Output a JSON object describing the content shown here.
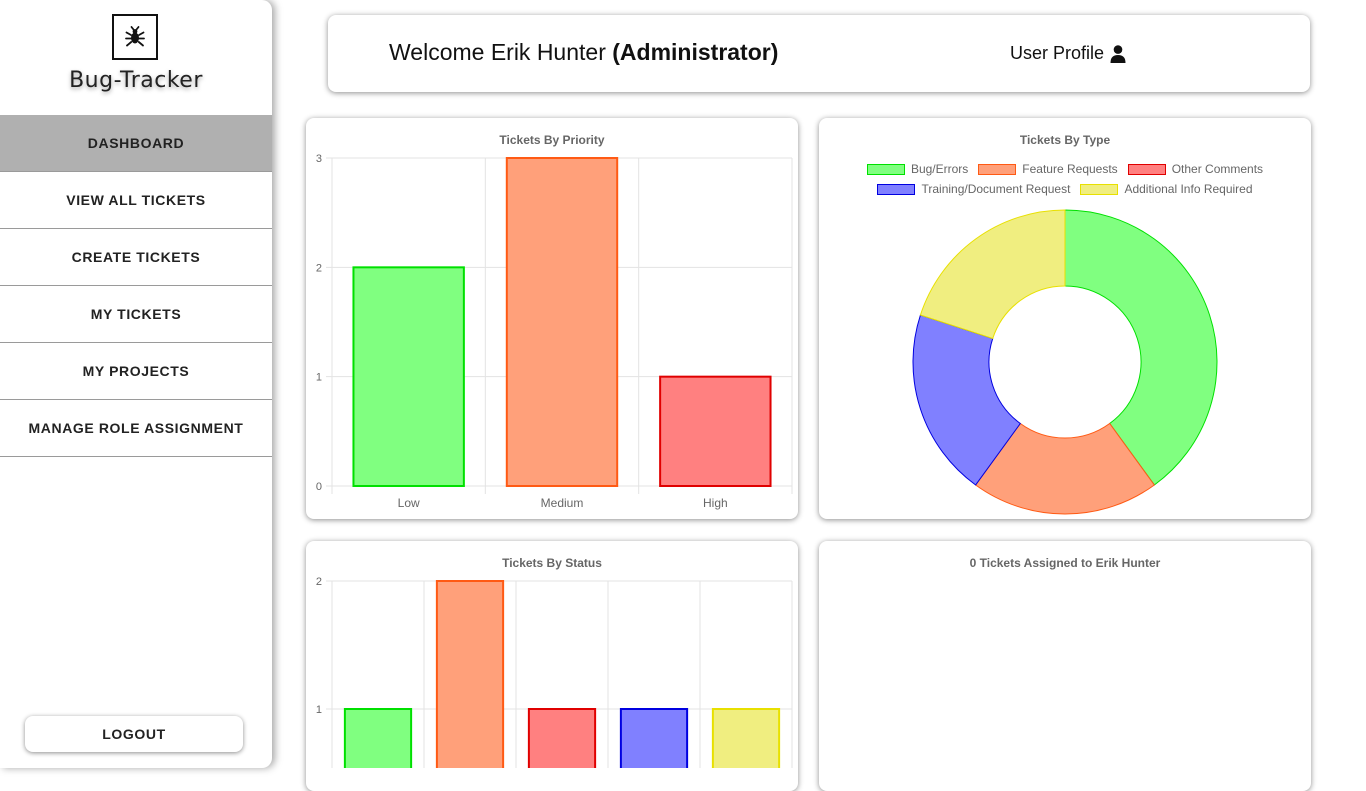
{
  "app": {
    "name": "Bug-Tracker"
  },
  "sidebar": {
    "items": [
      {
        "label": "DASHBOARD",
        "active": true
      },
      {
        "label": "VIEW ALL TICKETS",
        "active": false
      },
      {
        "label": "CREATE TICKETS",
        "active": false
      },
      {
        "label": "MY TICKETS",
        "active": false
      },
      {
        "label": "MY PROJECTS",
        "active": false
      },
      {
        "label": "MANAGE ROLE ASSIGNMENT",
        "active": false
      }
    ],
    "logout_label": "LOGOUT"
  },
  "header": {
    "welcome_prefix": "Welcome Erik Hunter",
    "role": "(Administrator)",
    "profile_label": "User Profile"
  },
  "palette": {
    "green": {
      "fill": "#80ff80",
      "stroke": "#00e000"
    },
    "orange": {
      "fill": "#ffa07a",
      "stroke": "#ff5a14"
    },
    "red": {
      "fill": "#ff8080",
      "stroke": "#e00000"
    },
    "blue": {
      "fill": "#8080ff",
      "stroke": "#0000e0"
    },
    "yellow": {
      "fill": "#f0ee80",
      "stroke": "#e8e000"
    }
  },
  "chart_data": [
    {
      "id": "priority",
      "type": "bar",
      "title": "Tickets By Priority",
      "categories": [
        "Low",
        "Medium",
        "High"
      ],
      "values": [
        2,
        3,
        1
      ],
      "colors": [
        "green",
        "orange",
        "red"
      ],
      "ylim": [
        0,
        3
      ],
      "yticks": [
        0,
        1,
        2,
        3
      ],
      "grid": true
    },
    {
      "id": "type",
      "type": "pie",
      "title": "Tickets By Type",
      "labels": [
        "Bug/Errors",
        "Feature Requests",
        "Other Comments",
        "Training/Document Request",
        "Additional Info Required"
      ],
      "values": [
        2,
        1,
        0,
        1,
        1
      ],
      "colors": [
        "green",
        "orange",
        "red",
        "blue",
        "yellow"
      ],
      "legend": "top"
    },
    {
      "id": "status",
      "type": "bar",
      "title": "Tickets By Status",
      "categories": [
        "",
        "",
        "",
        "",
        ""
      ],
      "values": [
        1,
        2,
        1,
        1,
        1
      ],
      "colors": [
        "green",
        "orange",
        "red",
        "blue",
        "yellow"
      ],
      "ylim": [
        0,
        2
      ],
      "yticks": [
        1,
        2
      ],
      "grid": true
    }
  ],
  "assigned": {
    "title": "0 Tickets Assigned to Erik Hunter"
  }
}
